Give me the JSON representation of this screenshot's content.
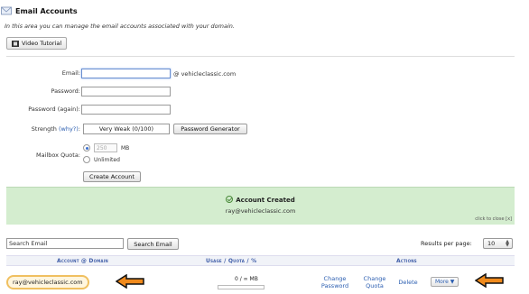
{
  "page": {
    "title": "Email Accounts",
    "intro": "In this area you can manage the email accounts associated with your domain.",
    "video_button": "Video Tutorial"
  },
  "form": {
    "email_label": "Email:",
    "email_value": "",
    "domain": "@ vehicleclassic.com",
    "password_label": "Password:",
    "password_again_label": "Password (again):",
    "strength_label": "Strength",
    "strength_why": "(why?)",
    "strength_colon": ":",
    "strength_value": "Very Weak (0/100)",
    "password_generator": "Password Generator",
    "quota_label": "Mailbox Quota:",
    "quota_value": "250",
    "quota_unit": "MB",
    "unlimited_label": "Unlimited",
    "create_button": "Create Account"
  },
  "success": {
    "heading": "Account Created",
    "address": "ray@vehicleclassic.com",
    "close_hint": "click to close [x]"
  },
  "search": {
    "input_value": "Search Email",
    "button": "Search Email",
    "results_label": "Results per page:",
    "results_value": "10"
  },
  "table": {
    "headers": {
      "account": "Account @ Domain",
      "usage": "Usage / Quota / %",
      "actions": "Actions"
    },
    "rows": [
      {
        "account": "ray@vehicleclassic.com",
        "usage": "0 / ∞ MB",
        "change_password": "Change Password",
        "change_quota": "Change Quota",
        "delete": "Delete",
        "more": "More ▼"
      }
    ]
  },
  "colors": {
    "accent_link": "#2a5db0",
    "success_bg": "#d4edcf",
    "arrow_orange": "#f08a1c",
    "highlight": "#f0c060"
  }
}
